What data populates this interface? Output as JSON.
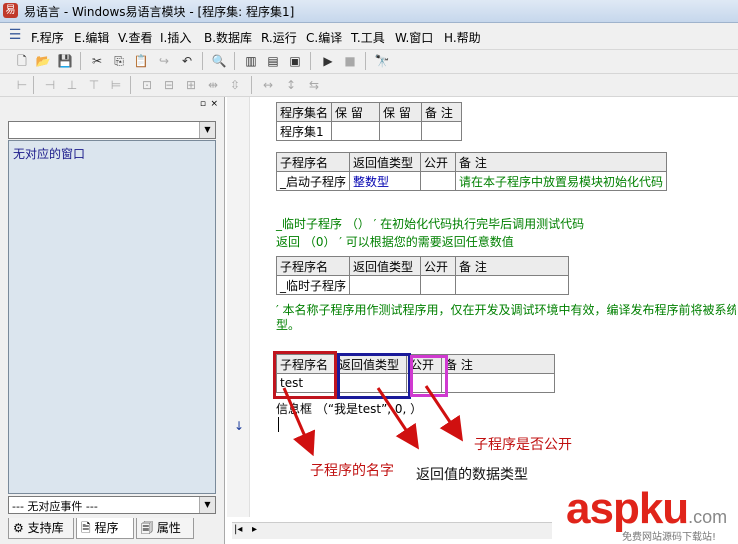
{
  "title": "易语言 - Windows易语言模块 - [程序集: 程序集1]",
  "menu": [
    {
      "key": "F",
      "label": "F.程序"
    },
    {
      "key": "E",
      "label": "E.编辑"
    },
    {
      "key": "V",
      "label": "V.查看"
    },
    {
      "key": "I",
      "label": "I.插入"
    },
    {
      "key": "B",
      "label": "B.数据库"
    },
    {
      "key": "R",
      "label": "R.运行"
    },
    {
      "key": "C",
      "label": "C.编译"
    },
    {
      "key": "T",
      "label": "T.工具"
    },
    {
      "key": "W",
      "label": "W.窗口"
    },
    {
      "key": "H",
      "label": "H.帮助"
    }
  ],
  "left_panel": {
    "window_list_item": "无对应的窗口",
    "event_combo": "--- 无对应事件 ---",
    "tabs": [
      "支持库",
      "程序",
      "属性"
    ]
  },
  "assembly_table": {
    "headers": [
      "程序集名",
      "保 留",
      "保 留",
      "备 注"
    ],
    "row": [
      "程序集1",
      "",
      "",
      ""
    ]
  },
  "sub_table_1": {
    "headers": [
      "子程序名",
      "返回值类型",
      "公开",
      "备 注"
    ],
    "row": [
      "_启动子程序",
      "整数型",
      "",
      "请在本子程序中放置易模块初始化代码"
    ]
  },
  "code_lines": {
    "line1": "_临时子程序 （） ′ 在初始化代码执行完毕后调用测试代码",
    "line2": "返回 （0） ′ 可以根据您的需要返回任意数值"
  },
  "sub_table_2": {
    "headers": [
      "子程序名",
      "返回值类型",
      "公开",
      "备 注"
    ],
    "row": [
      "_临时子程序",
      "",
      "",
      ""
    ]
  },
  "comment_line": "′ 本名称子程序用作测试程序用，仅在开发及调试环境中有效，编译发布程序前将被系统",
  "comment_line_wrap": "型。",
  "sub_table_3": {
    "headers": [
      "子程序名",
      "返回值类型",
      "公开",
      "备 注"
    ],
    "row": [
      "test",
      "",
      "",
      ""
    ]
  },
  "code_call": "信息框 （“我是test”, 0, ）",
  "annotations": {
    "name": "子程序的名字",
    "return_type": "返回值的数据类型",
    "public": "子程序是否公开"
  },
  "watermark": {
    "brand": "aspku",
    "suffix": ".com",
    "tagline": "免费网站源码下载站!"
  },
  "colors": {
    "red_box": "#c0141e",
    "blue_box": "#1a1a9a",
    "magenta_box": "#d03ad0",
    "arrow_red": "#d01010",
    "anno_red": "#c01010",
    "brand_red": "#e0241a"
  },
  "icons": [
    "new-file-icon",
    "open-icon",
    "save-icon",
    "cut-icon",
    "copy-icon",
    "paste-icon",
    "redo-icon",
    "undo-icon",
    "find-icon",
    "layout-icon",
    "run-icon",
    "stop-icon",
    "debug-icon"
  ]
}
